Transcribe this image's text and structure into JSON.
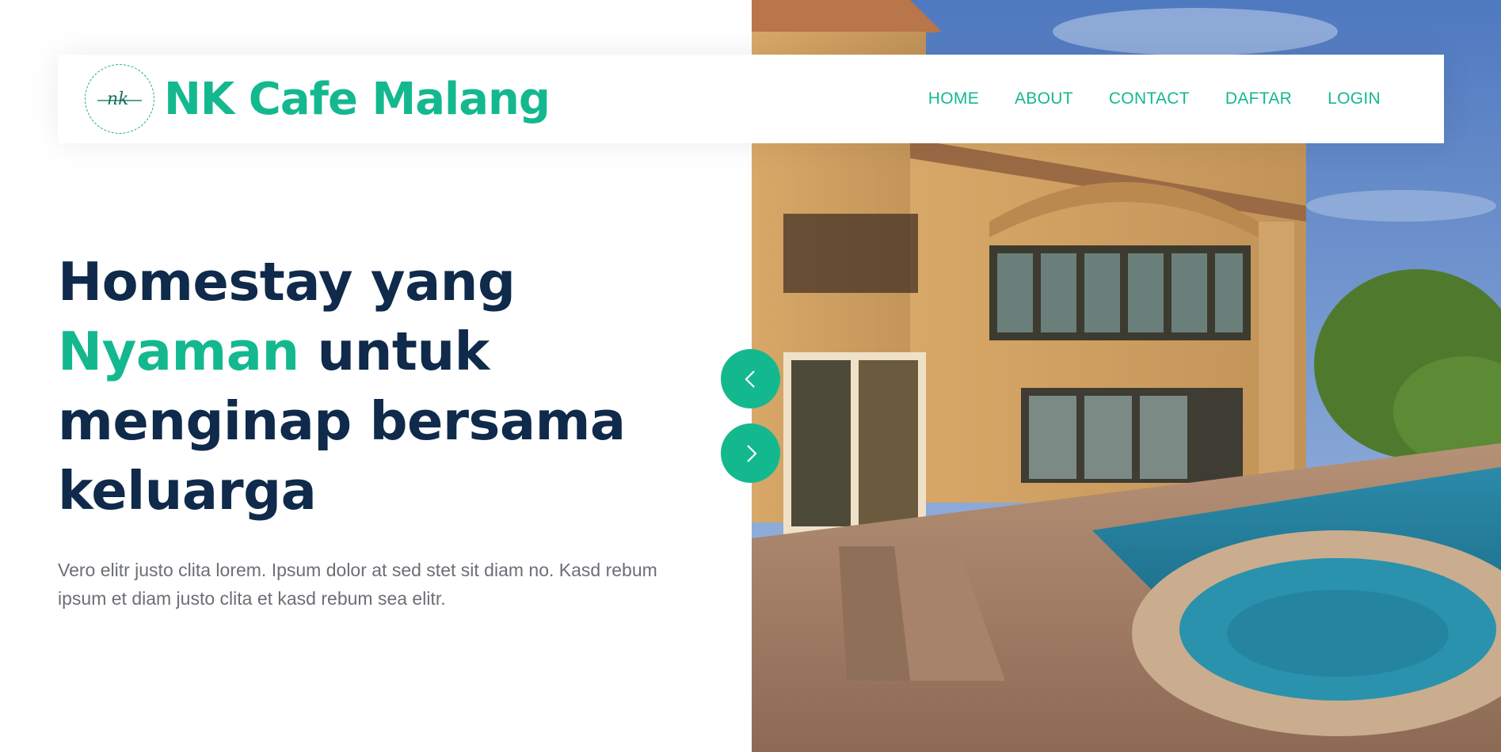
{
  "brand": {
    "name": "NK Cafe Malang",
    "logo_icon": "nk-logo-icon"
  },
  "nav": {
    "items": [
      "HOME",
      "ABOUT",
      "CONTACT",
      "DAFTAR",
      "LOGIN"
    ]
  },
  "hero": {
    "title_line1": "Homestay yang",
    "title_accent": "Nyaman",
    "title_after_accent": " untuk",
    "title_line3": "menginap bersama",
    "title_line4": "keluarga",
    "description": "Vero elitr justo clita lorem. Ipsum dolor at sed stet sit diam no. Kasd rebum ipsum et diam justo clita et kasd rebum sea elitr."
  },
  "carousel": {
    "prev_icon": "chevron-left-icon",
    "next_icon": "chevron-right-icon"
  },
  "colors": {
    "accent": "#14b88f",
    "heading": "#0f2a4a",
    "text": "#6b6f75"
  }
}
